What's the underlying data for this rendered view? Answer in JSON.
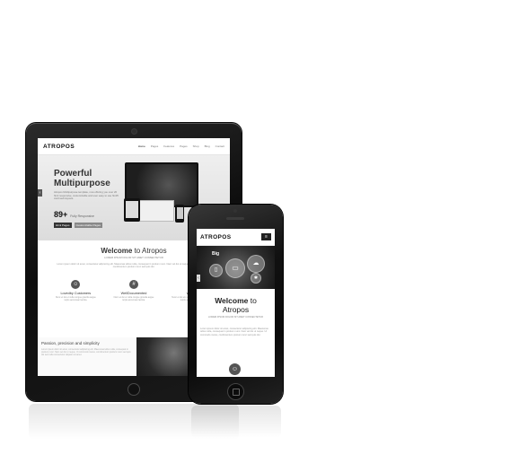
{
  "tablet": {
    "brand": "ATROPOS",
    "nav_items": [
      "Home",
      "Pages",
      "Features",
      "Pages",
      "Shop",
      "Blog",
      "Contact"
    ],
    "hero": {
      "title": "Powerful\nMultipurpose",
      "text": "Atropos Multipurpose template, now offering you over 20 html responsive, customizable and user easy to use html5 css3 web layouts.",
      "stat_number": "89+",
      "stat_label": "Fully Responsive",
      "badges": [
        "Html Pages",
        "Customizable Pages"
      ],
      "arrow": "‹"
    },
    "welcome": {
      "title_strong": "Welcome",
      "title_rest": " to Atropos",
      "subtitle": "LOREM IPSUM DOLOR SIT AMET CONSECTETUR",
      "paragraph": "Lorem ipsum dolor sit amet, consectetur adipiscing elit. Maecenas tellus nulla, consequat in pretium nunc. Nam vel dui ut neque. Ut commodo metus, condimentum pretium nunc sed quis dui."
    },
    "features": [
      {
        "icon": "users-icon",
        "title": "Lovedby Customers",
        "text": "Nunc et dui et nulla congue gravida augue turpis accumsan lacinia."
      },
      {
        "icon": "code-icon",
        "title": "WellDocumented",
        "text": "Nunc et dui et nulla congue gravida augue turpis accumsan lacinia."
      },
      {
        "icon": "heart-icon",
        "title": "Winner",
        "text": "Nunc et dui et nulla congue gravida augue turpis accumsan lacinia."
      }
    ],
    "bottom": {
      "title": "Passion, precision and simplicity",
      "text": "Lorem ipsum dolor sit amet, consectetur adipiscing elit. Maecenas tellus nulla, consequat in pretium nunc. Nam vel dui ut neque. Ut commodo metus, condimentum pretium nunc sed quis dui sed nulla consectetur aliquam sit amet."
    }
  },
  "phone": {
    "brand": "ATROPOS",
    "menu_icon": "≡",
    "hero_big": "Big",
    "hero_arrow": "‹",
    "welcome": {
      "title_strong": "Welcome",
      "title_rest": " to",
      "title_line2": "Atropos",
      "subtitle": "LOREM IPSUM DOLOR SIT AMET CONSECTETUR",
      "paragraph": "Lorem ipsum dolor sit amet, consectetur adipiscing elit. Maecenas tellus nulla, consequat in pretium nunc. Nam vel dui ut neque. Ut commodo metus, condimentum pretium nunc sed quis dui."
    },
    "feature_icon": "users-icon"
  }
}
